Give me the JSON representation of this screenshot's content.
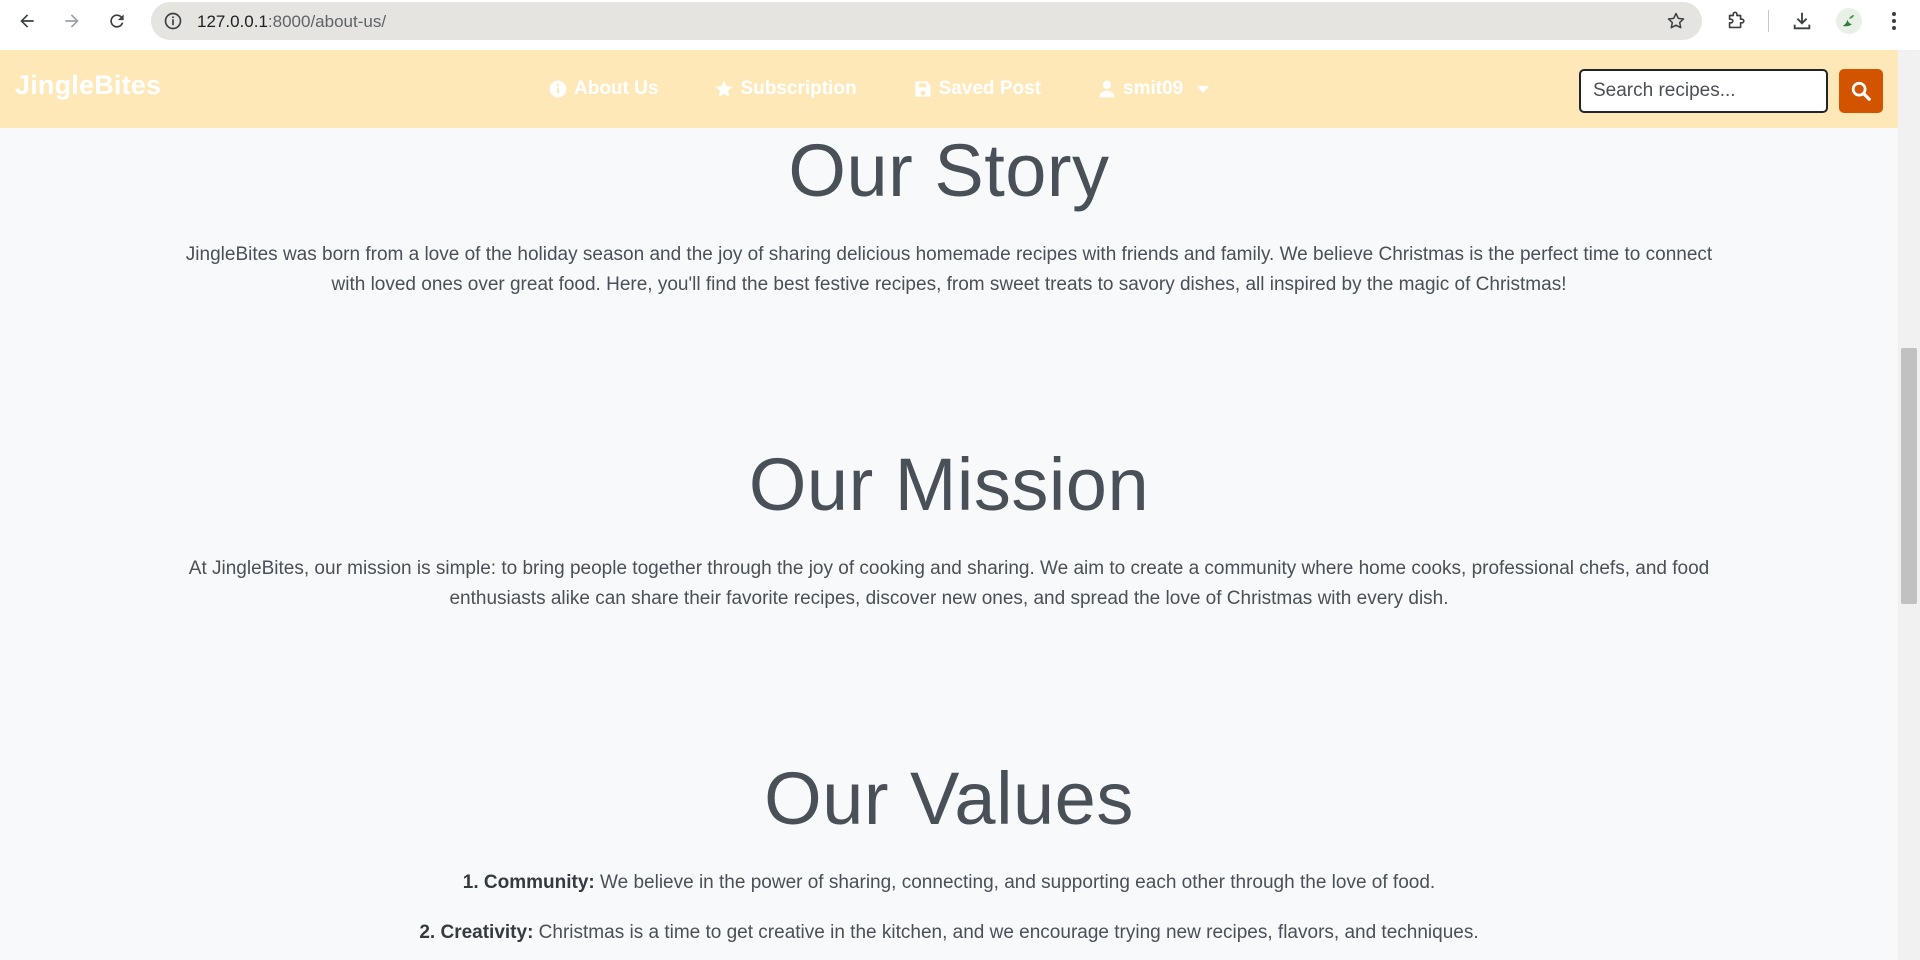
{
  "browser": {
    "url_host": "127.0.0.1",
    "url_path": ":8000/about-us/"
  },
  "site": {
    "brand": "JingleBites",
    "nav": {
      "about": "About Us",
      "subscription": "Subscription",
      "saved": "Saved Post",
      "user": "smit09"
    },
    "search": {
      "placeholder": "Search recipes..."
    }
  },
  "story": {
    "heading": "Our Story",
    "line1": "JingleBites was born from a love of the holiday season and the joy of sharing delicious homemade recipes with friends and family. We believe Christmas is the perfect time to connect",
    "line2": "with loved ones over great food. Here, you'll find the best festive recipes, from sweet treats to savory dishes, all inspired by the magic of Christmas!"
  },
  "mission": {
    "heading": "Our Mission",
    "line1": "At JingleBites, our mission is simple: to bring people together through the joy of cooking and sharing. We aim to create a community where home cooks, professional chefs, and food",
    "line2": "enthusiasts alike can share their favorite recipes, discover new ones, and spread the love of Christmas with every dish."
  },
  "values": {
    "heading": "Our Values",
    "items": [
      {
        "title": "1. Community:",
        "text": " We believe in the power of sharing, connecting, and supporting each other through the love of food."
      },
      {
        "title": "2. Creativity:",
        "text": " Christmas is a time to get creative in the kitchen, and we encourage trying new recipes, flavors, and techniques."
      }
    ]
  },
  "colors": {
    "navbar": "#ffe8b8",
    "search_button": "#d35400",
    "page_background": "#f8f9fa",
    "text": "#495057"
  }
}
